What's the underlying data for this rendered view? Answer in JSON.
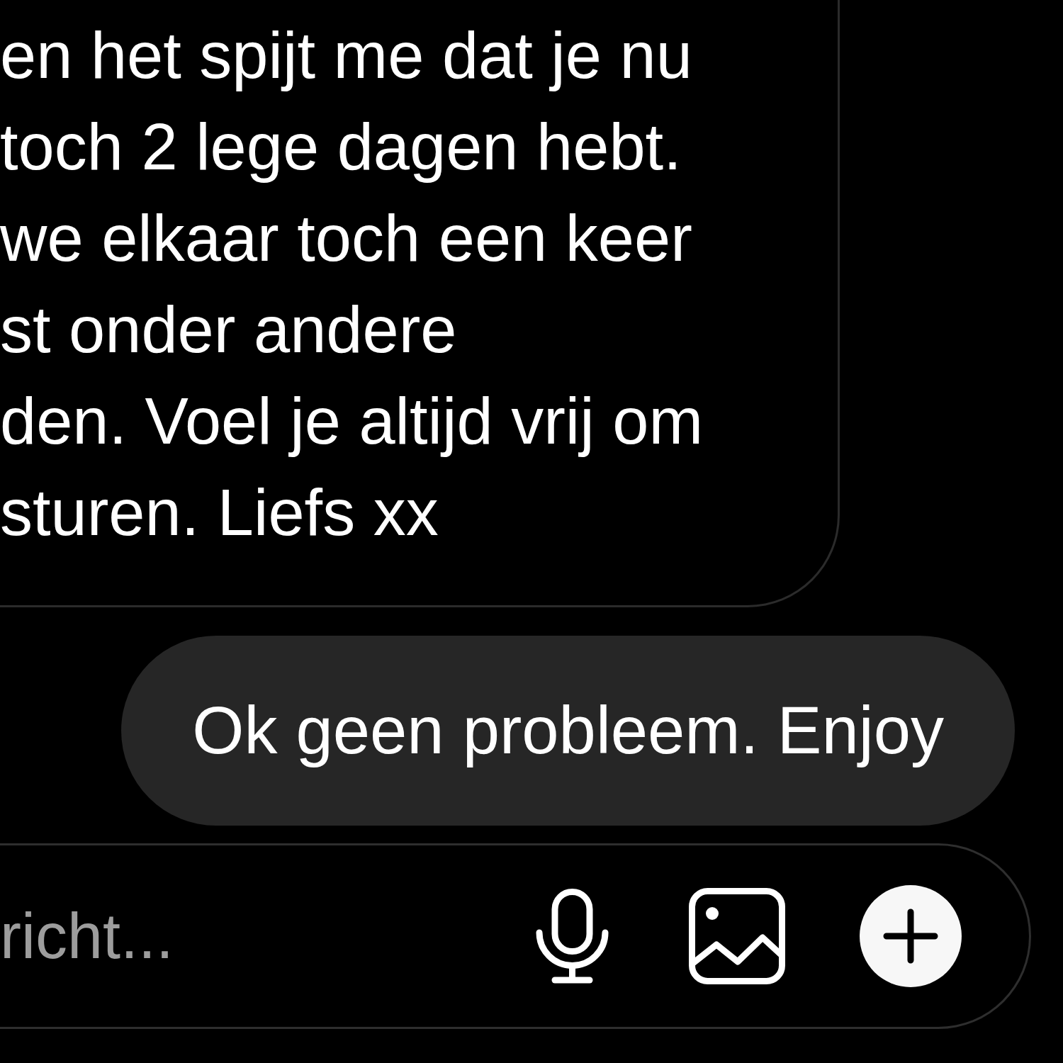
{
  "conversation": {
    "messages": [
      {
        "kind": "received",
        "lines": [
          "en het spijt me dat je nu",
          "toch 2 lege dagen hebt.",
          "we elkaar toch een keer",
          "st onder andere",
          "den. Voel je altijd vrij om",
          "sturen. Liefs xx"
        ]
      },
      {
        "kind": "sent",
        "text": "Ok geen probleem. Enjoy"
      }
    ]
  },
  "composer": {
    "placeholder": "richt..."
  }
}
